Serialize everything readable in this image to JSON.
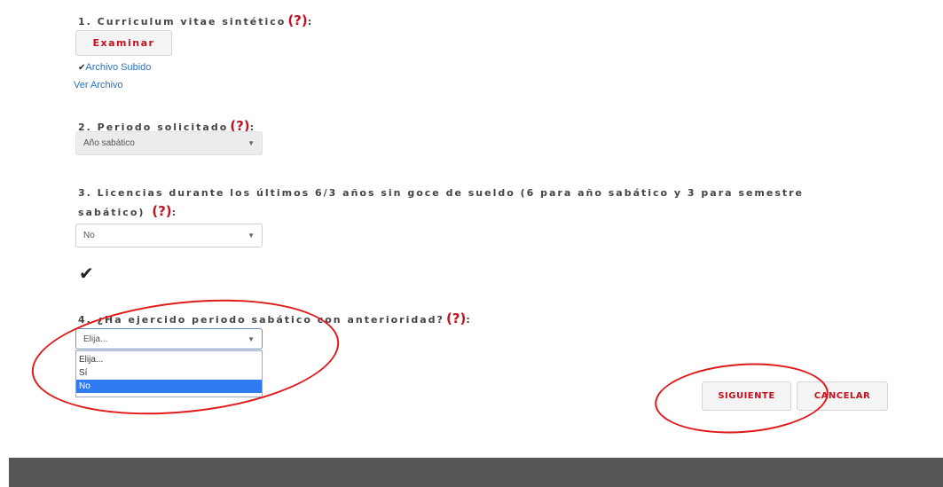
{
  "q1": {
    "label": "1. Curriculum vitae sintético",
    "help": "(?)",
    "suffix": ":",
    "browse_button": "Examinar",
    "uploaded_icon": "check-icon",
    "uploaded_text": "Archivo Subido",
    "view_link": "Ver Archivo"
  },
  "q2": {
    "label": "2. Periodo solicitado",
    "help": "(?)",
    "suffix": ":",
    "selected": "Año sabático"
  },
  "q3": {
    "label_line1": "3. Licencias durante los últimos 6/3 años sin goce de sueldo (6 para año sabático y 3 para semestre",
    "label_line2": "sabático) ",
    "help": "(?)",
    "suffix": ":",
    "selected": "No",
    "status_icon": "check-icon"
  },
  "q4": {
    "label": "4. ¿Ha ejercido periodo sabático con anterioridad?",
    "help": "(?)",
    "suffix": ":",
    "selected": "Elija...",
    "options": [
      "Elija...",
      "Sí",
      "No"
    ],
    "highlighted_option": "No"
  },
  "actions": {
    "next": "SIGUIENTE",
    "cancel": "CANCELAR"
  },
  "colors": {
    "accent": "#c1121f",
    "link": "#2a6fc4",
    "highlight": "#2f7cf0",
    "annotation": "#e01919",
    "footer": "#555555"
  }
}
